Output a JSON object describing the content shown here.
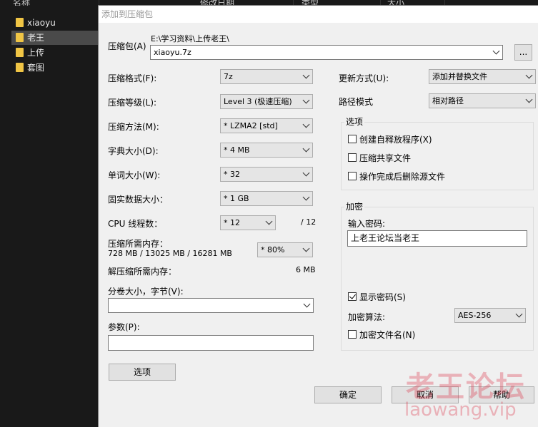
{
  "explorer": {
    "columns": [
      "名称",
      "修改日期",
      "类型",
      "大小"
    ],
    "folders": [
      "xiaoyu",
      "老王",
      "上传",
      "套图"
    ]
  },
  "dialog": {
    "title": "添加到压缩包",
    "archive": {
      "label": "压缩包(A)",
      "path": "E:\\学习资料\\上传老王\\",
      "name": "xiaoyu.7z",
      "browse": "..."
    },
    "left": {
      "format": {
        "label": "压缩格式(F):",
        "value": "7z"
      },
      "level": {
        "label": "压缩等级(L):",
        "value": "Level 3 (极速压缩)"
      },
      "method": {
        "label": "压缩方法(M):",
        "value": "* LZMA2 [std]"
      },
      "dict": {
        "label": "字典大小(D):",
        "value": "* 4 MB"
      },
      "word": {
        "label": "单词大小(W):",
        "value": "* 32"
      },
      "solid": {
        "label": "固实数据大小：",
        "value": "* 1 GB"
      },
      "cpu": {
        "label": "CPU 线程数：",
        "value": "* 12",
        "max": "/ 12"
      },
      "mem_compress": {
        "label": "压缩所需内存：",
        "detail": "728 MB / 13025 MB / 16281 MB",
        "value": "* 80%"
      },
      "mem_decompress": {
        "label": "解压缩所需内存：",
        "value": "6 MB"
      },
      "split": {
        "label": "分卷大小，字节(V):",
        "value": ""
      },
      "params": {
        "label": "参数(P):",
        "value": ""
      },
      "options_button": "选项"
    },
    "right": {
      "update": {
        "label": "更新方式(U):",
        "value": "添加并替换文件"
      },
      "pathmode": {
        "label": "路径模式",
        "value": "相对路径"
      },
      "options": {
        "title": "选项",
        "sfx": "创建自释放程序(X)",
        "shared": "压缩共享文件",
        "delete": "操作完成后删除源文件"
      },
      "encrypt": {
        "title": "加密",
        "password_label": "输入密码:",
        "password": "上老王论坛当老王",
        "show": "显示密码(S)",
        "method_label": "加密算法:",
        "method": "AES-256",
        "encrypt_names": "加密文件名(N)"
      }
    },
    "buttons": {
      "ok": "确定",
      "cancel": "取消",
      "help": "帮助"
    }
  },
  "watermark": {
    "cn": "老王论坛",
    "en": "laowang.vip"
  }
}
